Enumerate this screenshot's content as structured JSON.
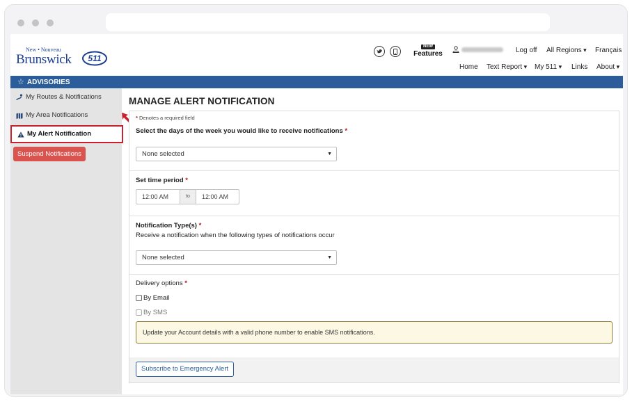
{
  "header": {
    "logo_small": "New • Nouveau",
    "logo_big": "Brunswick",
    "logo_badge": "511",
    "features_new": "NEW",
    "features_label": "Features",
    "logout": "Log off",
    "regions": "All Regions",
    "language": "Français",
    "nav": {
      "home": "Home",
      "text_report": "Text Report",
      "my511": "My 511",
      "links": "Links",
      "about": "About"
    }
  },
  "advisories_bar": {
    "label": "ADVISORIES"
  },
  "sidebar": {
    "items": [
      {
        "label": "My Routes & Notifications",
        "icon": "route-icon"
      },
      {
        "label": "My Area Notifications",
        "icon": "map-icon"
      },
      {
        "label": "My Alert Notification",
        "icon": "warning-icon"
      }
    ],
    "suspend_label": "Suspend Notifications"
  },
  "main": {
    "title": "MANAGE ALERT NOTIFICATION",
    "required_note": "Denotes a required field",
    "required_marker": "*",
    "days": {
      "label": "Select the days of the week you would like to receive notifications",
      "value": "None selected"
    },
    "time": {
      "label": "Set time period",
      "from": "12:00 AM",
      "to_label": "to",
      "to": "12:00 AM"
    },
    "types": {
      "label": "Notification Type(s)",
      "help": "Receive a notification when the following types of notifications occur",
      "value": "None selected"
    },
    "delivery": {
      "label": "Delivery options",
      "email": "By Email",
      "sms": "By SMS",
      "warning": "Update your Account details with a valid phone number to enable SMS notifications."
    },
    "subscribe_label": "Subscribe to Emergency Alert"
  },
  "colors": {
    "brand_blue": "#2a5d9a",
    "danger": "#d9534f",
    "highlight": "#c7202f",
    "warning_bg": "#fcf8e3"
  }
}
